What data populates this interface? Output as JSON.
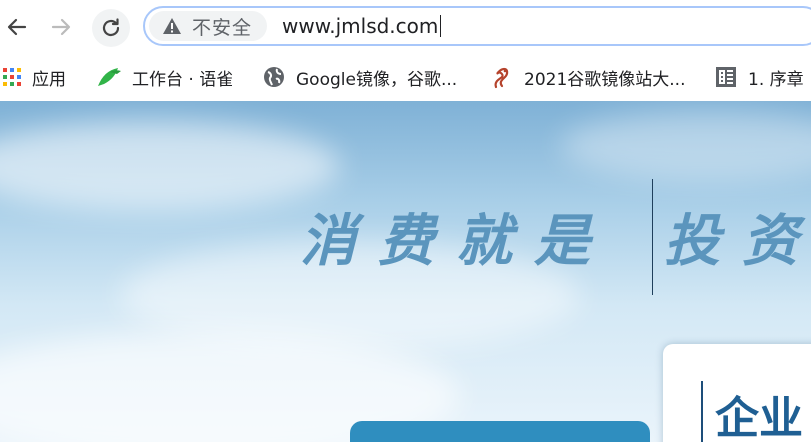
{
  "toolbar": {
    "security_label": "不安全",
    "url": "www.jmlsd.com"
  },
  "bookmarks": [
    {
      "label": "应用",
      "icon": "apps-grid-icon"
    },
    {
      "label": "工作台 · 语雀",
      "icon": "yuque-bird-icon"
    },
    {
      "label": "Google镜像，谷歌...",
      "icon": "globe-icon"
    },
    {
      "label": "2021谷歌镜像站大...",
      "icon": "dragon-icon"
    },
    {
      "label": "1. 序章",
      "icon": "book-icon"
    }
  ],
  "hero": {
    "slogan_left": "消费就是",
    "slogan_right": "投资",
    "panel_title": "企业"
  },
  "colors": {
    "omnibox_border": "#a8c7fa",
    "slogan": "#5b95bd",
    "panel_title": "#1f5f93"
  }
}
